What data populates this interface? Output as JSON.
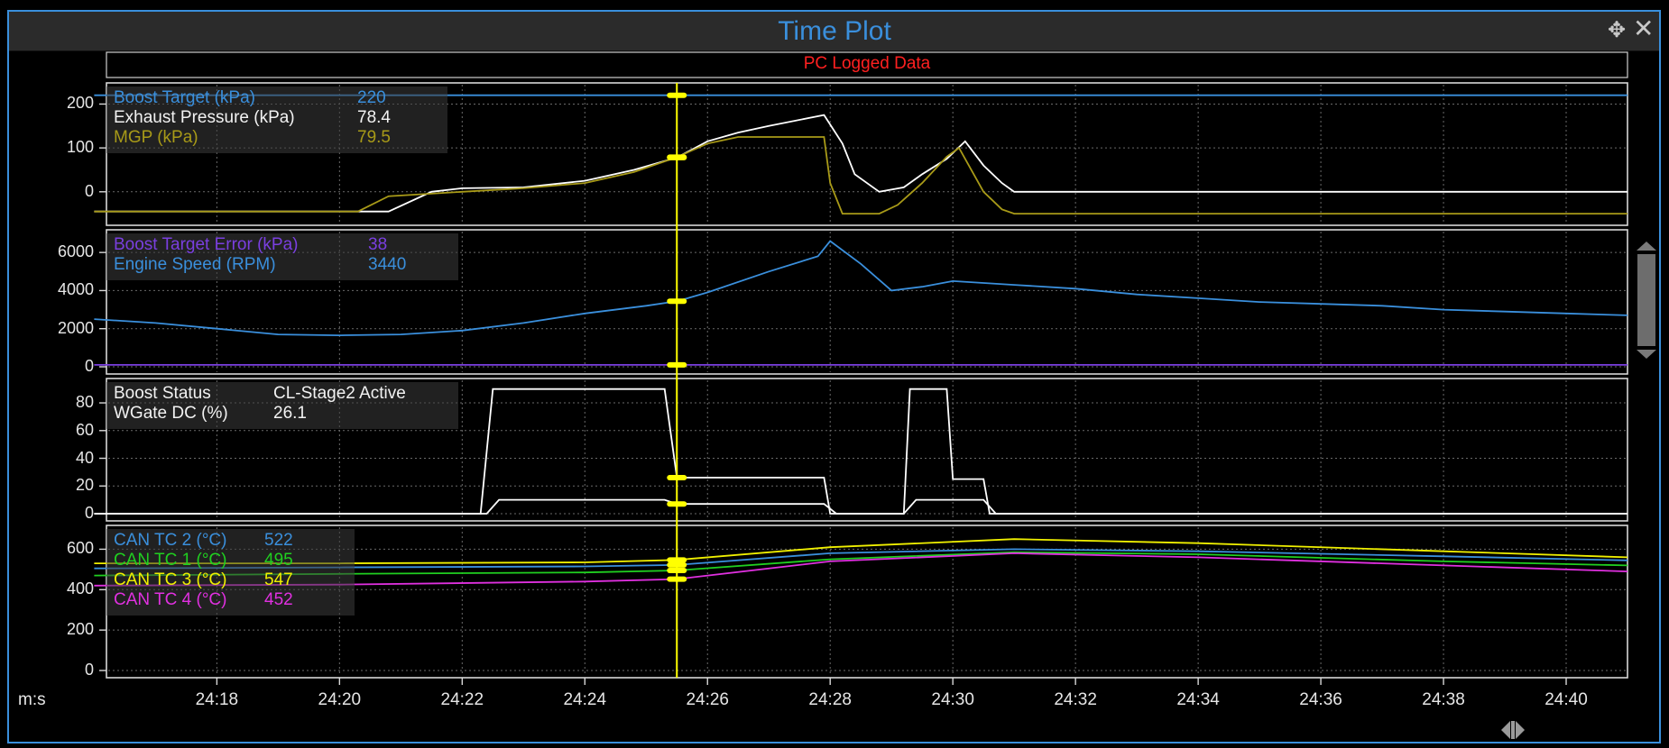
{
  "window": {
    "title": "Time Plot",
    "move_icon": "move-crosshair-icon",
    "close_icon": "close-icon",
    "subtitle": "PC Logged Data"
  },
  "x_axis": {
    "unit_label": "m:s",
    "ticks": [
      "24:18",
      "24:20",
      "24:22",
      "24:24",
      "24:26",
      "24:28",
      "24:30",
      "24:32",
      "24:34",
      "24:36",
      "24:38",
      "24:40"
    ]
  },
  "cursor": {
    "time": "24:25.5",
    "color": "#ffff00"
  },
  "colors": {
    "background": "#000000",
    "grid": "#6a6a6a",
    "title": "#3a8fdc",
    "subtitle": "#ff2020"
  },
  "chart_data": [
    {
      "type": "line",
      "panel": 1,
      "ylim": [
        -60,
        240
      ],
      "yticks": [
        "200",
        "100",
        "0"
      ],
      "x_unit": "seconds past 24:00",
      "series": [
        {
          "name": "Boost Target (kPa)",
          "cursor_value": "220",
          "color": "#3a8fdc",
          "x": [
            16,
            41
          ],
          "y": [
            220,
            220
          ]
        },
        {
          "name": "Exhaust Pressure (kPa)",
          "cursor_value": "78.4",
          "color": "#ffffff",
          "x": [
            16,
            20.8,
            21.5,
            22,
            23,
            24,
            24.8,
            25.5,
            26,
            26.5,
            27,
            27.9,
            28.2,
            28.4,
            28.8,
            29.2,
            29.5,
            29.9,
            30.2,
            30.5,
            30.8,
            31,
            33,
            39,
            41
          ],
          "y": [
            -45,
            -45,
            0,
            8,
            10,
            25,
            50,
            78,
            115,
            135,
            150,
            175,
            110,
            40,
            0,
            10,
            40,
            75,
            115,
            60,
            20,
            0,
            0,
            0,
            0
          ]
        },
        {
          "name": "MGP (kPa)",
          "cursor_value": "79.5",
          "color": "#a89a18",
          "x": [
            16,
            20.3,
            20.8,
            22,
            23,
            24,
            24.8,
            25.5,
            26,
            26.5,
            27,
            27.9,
            28,
            28.2,
            28.8,
            29.1,
            29.5,
            29.9,
            30.1,
            30.5,
            30.8,
            31,
            33,
            39,
            41
          ],
          "y": [
            -45,
            -45,
            -10,
            0,
            8,
            20,
            45,
            79,
            110,
            125,
            125,
            125,
            20,
            -50,
            -50,
            -30,
            20,
            80,
            100,
            0,
            -40,
            -50,
            -50,
            -50,
            -50
          ]
        }
      ]
    },
    {
      "type": "line",
      "panel": 2,
      "ylim": [
        0,
        7000
      ],
      "yticks": [
        "6000",
        "4000",
        "2000",
        "0"
      ],
      "x_unit": "seconds past 24:00",
      "series": [
        {
          "name": "Boost Target Error (kPa)",
          "cursor_value": "38",
          "color": "#7a3fe0",
          "x": [
            16,
            41
          ],
          "y": [
            100,
            100
          ]
        },
        {
          "name": "Engine Speed (RPM)",
          "cursor_value": "3440",
          "color": "#3a8fdc",
          "x": [
            16,
            17,
            18,
            19,
            20,
            21,
            22,
            23,
            24,
            25,
            25.5,
            26,
            27,
            27.8,
            28,
            28.5,
            29,
            29.5,
            30,
            30.5,
            31,
            32,
            33,
            34,
            35,
            36,
            37,
            38,
            39,
            40,
            41
          ],
          "y": [
            2500,
            2300,
            2000,
            1700,
            1650,
            1700,
            1900,
            2300,
            2800,
            3200,
            3440,
            3900,
            5000,
            5800,
            6600,
            5400,
            4000,
            4200,
            4500,
            4400,
            4300,
            4100,
            3800,
            3600,
            3400,
            3300,
            3200,
            3000,
            2900,
            2800,
            2700
          ]
        }
      ]
    },
    {
      "type": "line",
      "panel": 3,
      "ylim": [
        0,
        95
      ],
      "yticks": [
        "80",
        "60",
        "40",
        "20",
        "0"
      ],
      "x_unit": "seconds past 24:00",
      "series": [
        {
          "name": "Boost Status",
          "cursor_value": "CL-Stage2 Active",
          "color": "#ffffff",
          "x": [
            16,
            22.4,
            22.6,
            25.3,
            25.5,
            27.9,
            28.1,
            29.2,
            29.4,
            30.5,
            30.7,
            41
          ],
          "y": [
            0,
            0,
            10,
            10,
            7,
            7,
            0,
            0,
            10,
            10,
            0,
            0
          ]
        },
        {
          "name": "WGate DC (%)",
          "cursor_value": "26.1",
          "color": "#ffffff",
          "x": [
            16,
            22.3,
            22.5,
            25.3,
            25.5,
            27.9,
            28,
            29.2,
            29.3,
            29.9,
            30,
            30.5,
            30.6,
            41
          ],
          "y": [
            0,
            0,
            90,
            90,
            26,
            26,
            0,
            0,
            90,
            90,
            25,
            25,
            0,
            0
          ]
        }
      ]
    },
    {
      "type": "line",
      "panel": 4,
      "ylim": [
        0,
        700
      ],
      "yticks": [
        "600",
        "400",
        "200",
        "0"
      ],
      "x_unit": "seconds past 24:00",
      "series": [
        {
          "name": "CAN TC 2 (°C)",
          "cursor_value": "522",
          "color": "#3a8fdc",
          "x": [
            16,
            20,
            24,
            25.5,
            28,
            31,
            34,
            38,
            41
          ],
          "y": [
            505,
            510,
            515,
            522,
            580,
            600,
            590,
            565,
            545
          ]
        },
        {
          "name": "CAN TC 1 (°C)",
          "cursor_value": "495",
          "color": "#20d020",
          "x": [
            16,
            20,
            24,
            25.5,
            28,
            31,
            34,
            38,
            41
          ],
          "y": [
            470,
            478,
            485,
            495,
            550,
            585,
            575,
            540,
            520
          ]
        },
        {
          "name": "CAN TC 3 (°C)",
          "cursor_value": "547",
          "color": "#f0f000",
          "x": [
            16,
            20,
            24,
            25.5,
            28,
            31,
            34,
            38,
            41
          ],
          "y": [
            530,
            530,
            535,
            547,
            610,
            650,
            630,
            590,
            560
          ]
        },
        {
          "name": "CAN TC 4 (°C)",
          "cursor_value": "452",
          "color": "#e030e0",
          "x": [
            16,
            20,
            24,
            25.5,
            28,
            31,
            34,
            38,
            41
          ],
          "y": [
            420,
            425,
            440,
            452,
            540,
            580,
            560,
            520,
            490
          ]
        }
      ]
    }
  ]
}
